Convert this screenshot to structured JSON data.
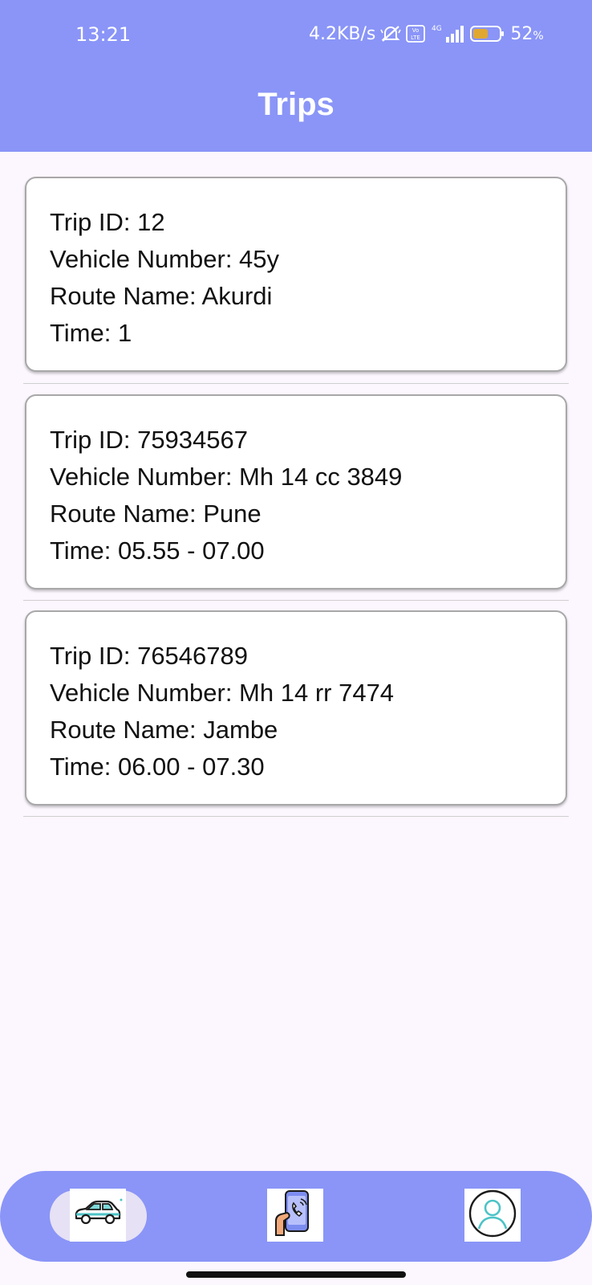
{
  "status_bar": {
    "time": "13:21",
    "speed": "4.2KB/s",
    "battery_percent": "52",
    "battery_unit": "%",
    "icons": [
      "mute-alarm-icon",
      "volte-icon",
      "4g-signal-icon",
      "battery-icon"
    ]
  },
  "header": {
    "title": "Trips"
  },
  "trips": [
    {
      "trip_id": "Trip ID: 12",
      "vehicle": "Vehicle Number: 45y",
      "route": "Route Name: Akurdi",
      "time": "Time: 1"
    },
    {
      "trip_id": "Trip ID: 75934567",
      "vehicle": "Vehicle Number: Mh 14 cc 3849",
      "route": "Route Name: Pune",
      "time": "Time: 05.55 - 07.00"
    },
    {
      "trip_id": "Trip ID: 76546789",
      "vehicle": "Vehicle Number: Mh 14 rr 7474",
      "route": "Route Name: Jambe",
      "time": "Time: 06.00 - 07.30"
    }
  ],
  "bottom_nav": {
    "items": [
      {
        "icon": "car-icon",
        "selected": true
      },
      {
        "icon": "phone-call-icon",
        "selected": false
      },
      {
        "icon": "profile-icon",
        "selected": false
      }
    ]
  },
  "colors": {
    "primary": "#8a95f7",
    "background": "#fcf6fe",
    "selected_pill": "#e6e1f4"
  }
}
